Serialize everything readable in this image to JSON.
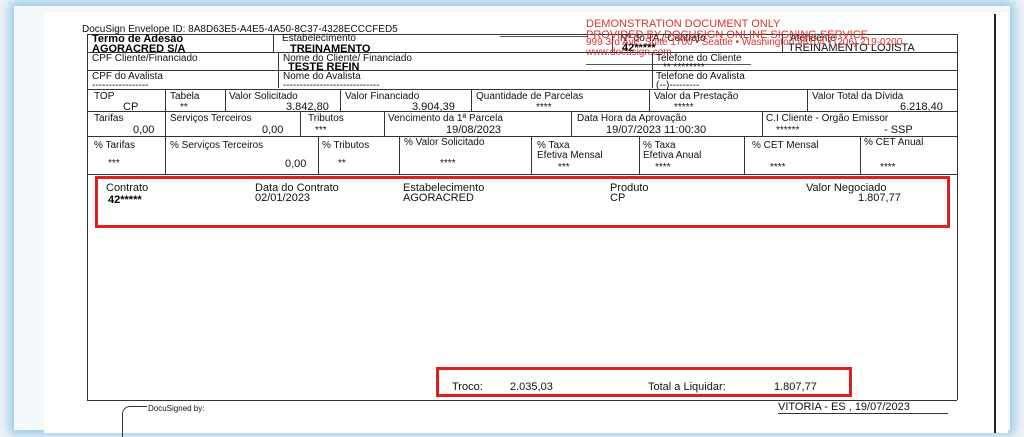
{
  "envelope": {
    "id_text": "DocuSign Envelope ID: 8A8D63E5-A4E5-4A50-8C37-4328ECCCFED5"
  },
  "demo": {
    "line1": "DEMONSTRATION DOCUMENT ONLY",
    "line2": "PROVIDED BY DOCUSIGN ONLINE SIGNING SERVICE",
    "line3": "999 3rd Ave, Suite 1700 • Seattle • Washington 98104 • (206) 219-0200",
    "line4": "www.docusign.com"
  },
  "header": {
    "termo_label": "Termo de Adesão",
    "termo_value": "AGORACRED S/A",
    "estab_label": "Estabelecimento",
    "estab_value": "TREINAMENTO",
    "ta_label": "Nº do TA / Contrato",
    "ta_value": "42*****",
    "atendente_label": "Atendente",
    "atendente_value": "TREINAMENTO LOJISTA"
  },
  "client": {
    "cpf_label": "CPF Cliente/Financiado",
    "nome_label": "Nome do Cliente/ Financiado",
    "nome_value": "TESTE REFIN",
    "tel_label": "Telefone do Cliente",
    "tel_value": "** ********",
    "cpf_aval_label": "CPF do Avalista",
    "cpf_aval_value": "-----------------",
    "nome_aval_label": "Nome do Avalista",
    "nome_aval_value": "-----------------------------",
    "tel_aval_label": "Telefone do Avalista",
    "tel_aval_value": "(--)---------"
  },
  "row1": {
    "top_label": "TOP",
    "top_value": "CP",
    "tabela_label": "Tabela",
    "tabela_value": "**",
    "vsol_label": "Valor Solicitado",
    "vsol_value": "3.842,80",
    "vfin_label": "Valor Financiado",
    "vfin_value": "3.904,39",
    "qtd_label": "Quantidade de Parcelas",
    "qtd_value": "****",
    "vprest_label": "Valor da Prestação",
    "vprest_value": "*****",
    "vtot_label": "Valor Total da Dívida",
    "vtot_value": "6.218,40"
  },
  "row2": {
    "tarifas_label": "Tarifas",
    "tarifas_value": "0,00",
    "serv_label": "Serviços Terceiros",
    "serv_value": "0,00",
    "trib_label": "Tributos",
    "trib_value": "***",
    "venc_label": "Vencimento da 1ª Parcela",
    "venc_value": "19/08/2023",
    "data_label": "Data Hora da Aprovação",
    "data_value": "19/07/2023  11:00:30",
    "ci_label": "C.I Cliente - Orgão Emissor",
    "ci_value": "******",
    "ci_org": "- SSP"
  },
  "row3": {
    "ptarifas_label": "% Tarifas",
    "ptarifas_value": "***",
    "pserv_label": "% Serviços Terceiros",
    "pserv_value": "0,00",
    "ptrib_label": "% Tributos",
    "ptrib_value": "**",
    "pvsol_label": "% Valor Solicitado",
    "pvsol_value": "****",
    "ptaxam_label1": "% Taxa",
    "ptaxam_label2": "Efetiva Mensal",
    "ptaxam_value": "***",
    "ptaxaa_label1": "% Taxa",
    "ptaxaa_label2": "Efetiva Anual",
    "ptaxaa_value": "****",
    "pcetm_label": "% CET Mensal",
    "pcetm_value": "****",
    "pceta_label": "% CET Anual",
    "pceta_value": "****"
  },
  "contract": {
    "contrato_label": "Contrato",
    "contrato_value": "42*****",
    "data_label": "Data do Contrato",
    "data_value": "02/01/2023",
    "estab_label": "Estabelecimento",
    "estab_value": "AGORACRED",
    "produto_label": "Produto",
    "produto_value": "CP",
    "valor_label": "Valor Negociado",
    "valor_value": "1.807,77"
  },
  "totals": {
    "troco_label": "Troco:",
    "troco_value": "2.035,03",
    "liquidar_label": "Total a Liquidar:",
    "liquidar_value": "1.807,77"
  },
  "footer": {
    "docusigned": "DocuSigned by:",
    "place_date": "VITORIA - ES , 19/07/2023"
  },
  "colors": {
    "highlight": "#e02020",
    "demo_text": "#e03030",
    "glow": "#8fc6ec"
  }
}
